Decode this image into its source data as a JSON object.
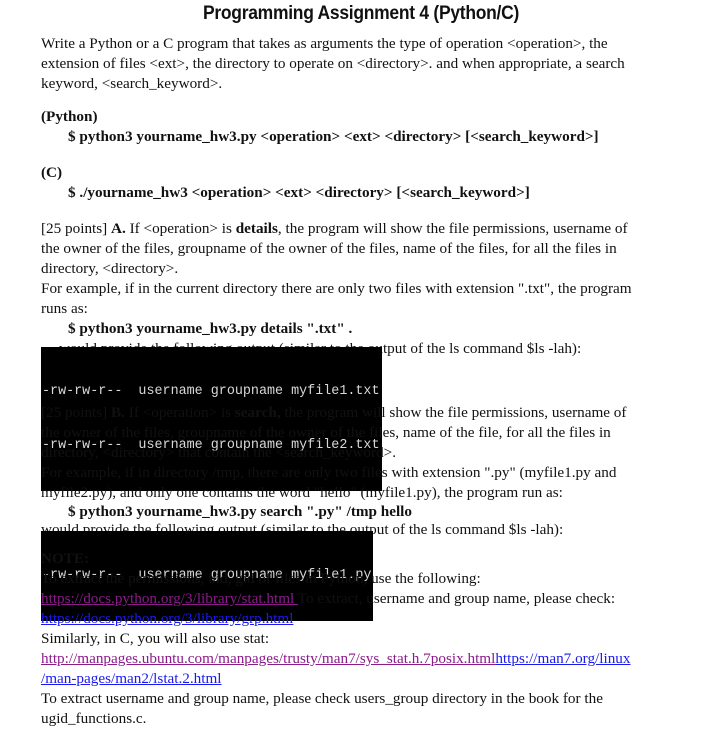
{
  "title": "Programming Assignment 4  (Python/C)",
  "intro": "Write a Python or a C program that takes as arguments the type of operation <operation>, the extension of files <ext>, the directory to operate on <directory>. and when appropriate, a search keyword, <search_keyword>.",
  "intro_lines": [
    "Write a Python or a C program that takes as arguments the type of operation <operation>, the",
    "extension of files <ext>, the directory to operate on <directory>. and when appropriate, a search",
    "keyword, <search_keyword>."
  ],
  "usage": {
    "python_label": "(Python)",
    "python_cmd": "$ python3  yourname_hw3.py  <operation>  <ext>  <directory> [<search_keyword>]",
    "c_label": "(C)",
    "c_cmd": "$ ./yourname_hw3  <operation>  <ext>  <directory> [<search_keyword>]"
  },
  "part_a": {
    "points": "[25 points] ",
    "letter": "A.",
    "text1": " If <operation> is ",
    "keyword": "details",
    "line1_rest": ", the program will show the file permissions, username of",
    "line2": "the owner of the files, groupname of the owner of the files, name of the files, for all the files in",
    "line3": "directory, <directory>.",
    "line4": "For example, if in the current directory there are only two files with extension \".txt\", the program",
    "line5": "runs as:",
    "command": "$ python3  yourname_hw3.py  details \".txt\" .",
    "output_intro": "would provide the following output (similar to the output of the ls command $ls -lah):",
    "output": [
      "-rw-rw-r--  username groupname myfile1.txt",
      "-rw-rw-r--  username groupname myfile2.txt"
    ]
  },
  "part_b": {
    "points": "[25 points] ",
    "letter": "B.",
    "text1": " If <operation> is ",
    "keyword": "search,",
    "line1_rest": " the program will show the file permissions, username of",
    "line2": "the owner of the files, groupname of the owner of the files, name of the file, for all the files in",
    "line3": "directory, <directory> that contain the <search_keyword>.",
    "line4": "For example, if in directory /tmp, there are only two files with extension \".py\" (myfile1.py and",
    "line5": "myfile2.py), and only one contains the word \"hello\" (myfile1.py), the program run as:",
    "command": "$ python3  yourname_hw3.py  search \".py\" /tmp hello",
    "output_intro": "would provide the following output (similar to the output of the ls command $ls -lah):",
    "output": [
      "-rw-rw-r--  username groupname myfile1.py"
    ]
  },
  "note": {
    "heading": "NOTE:",
    "line1": "To extract the permissions, uid, gid of files in Python, use the following:",
    "link_stat": "https://docs.python.org/3/library/stat.html ",
    "line2_rest": " To extract, username and group name, please check:",
    "link_grp": "https://docs.python.org/3/library/grp.html",
    "line3": "Similarly, in C, you will also use stat:",
    "link_ubuntu": "http://manpages.ubuntu.com/manpages/trusty/man7/sys_stat.h.7posix.html",
    "link_man7_part1": "https://man7.org/linux",
    "link_man7_part2": "/man-pages/man2/lstat.2.html",
    "line5": "To extract username and group name, please check users_group directory in the book for the",
    "line6": "ugid_functions.c."
  },
  "colors": {
    "visited_link": "#8b1a8b",
    "link": "#1a1aee",
    "terminal_bg": "#000000",
    "terminal_fg": "#d8d8d8"
  }
}
